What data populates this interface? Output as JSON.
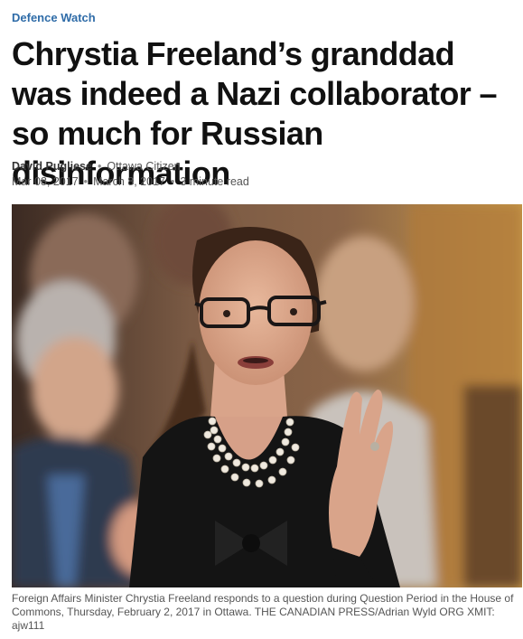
{
  "section": {
    "label": "Defence Watch"
  },
  "headline": "Chrystia Freeland’s granddad was indeed a Nazi collaborator – so much for Russian disinformation",
  "byline": {
    "author": "David Pugliese",
    "outlet": "Ottawa Citizen",
    "separator": "•"
  },
  "dates": {
    "published": "Mar 08, 2017",
    "updated": "March 8, 2017",
    "read_time": "3 minute read",
    "separator": "•"
  },
  "photo": {
    "subject": "woman-speaking-in-parliament"
  },
  "caption": "Foreign Affairs Minister Chrystia Freeland responds to a question during Question Period in the House of Commons, Thursday, February 2, 2017 in Ottawa. THE CANADIAN PRESS/Adrian Wyld ORG XMIT: ajw111",
  "colors": {
    "section_label": "#2f6ca8",
    "headline": "#111111",
    "meta_text": "#555555"
  }
}
